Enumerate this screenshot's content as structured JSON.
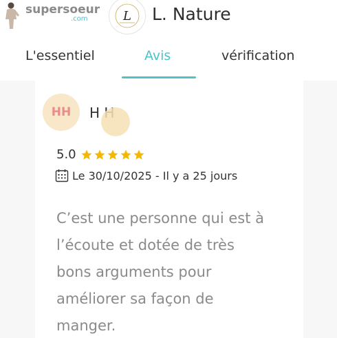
{
  "header": {
    "brand_name": "supersoeur",
    "brand_domain": ".com",
    "shop_logo_text": "L",
    "shop_name": "L. Nature"
  },
  "tabs": [
    {
      "label": "L'essentiel",
      "active": false
    },
    {
      "label": "Avis",
      "active": true
    },
    {
      "label": "vérification",
      "active": false
    }
  ],
  "review": {
    "avatar_initials": "HH",
    "reviewer_name": "H H",
    "rating": "5.0",
    "stars": 5,
    "date_text": "Le 30/10/2025 - Il y a 25 jours",
    "body_lines": [
      "C’est une personne qui est à",
      "l’écoute et dotée de très",
      "bons arguments pour",
      "améliorer sa façon de",
      "manger."
    ]
  },
  "colors": {
    "accent": "#4ec2c9",
    "star": "#f5b800",
    "avatar_bg": "#f8e7c8",
    "avatar_text": "#e88c8c",
    "muted_text": "#8a8a8a"
  },
  "icons": {
    "brand": "woman-figure-icon",
    "calendar": "calendar-icon",
    "star": "star-icon"
  }
}
